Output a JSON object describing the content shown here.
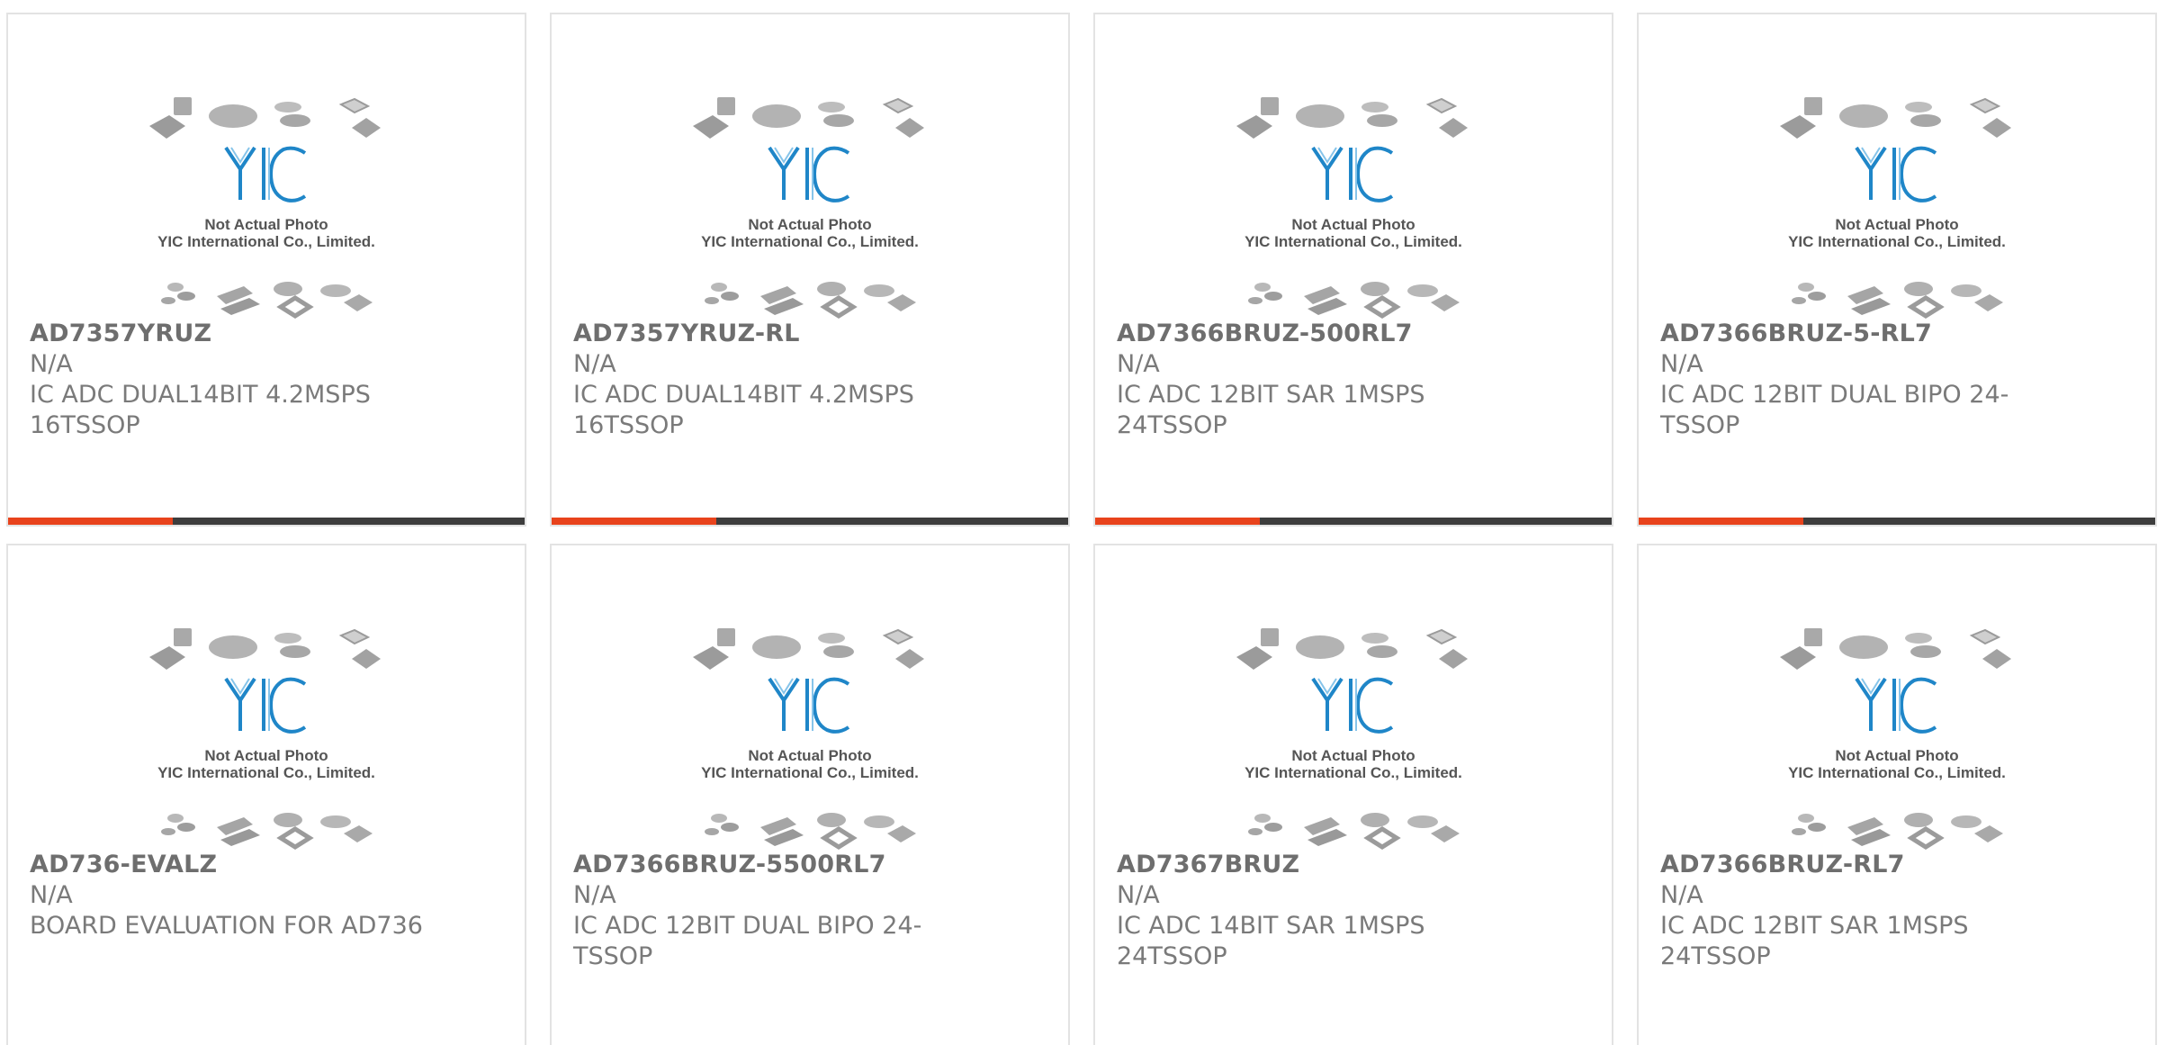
{
  "image_caption": {
    "line1": "Not Actual Photo",
    "line2": "YIC International Co., Limited.",
    "logo_text": "YIC"
  },
  "colors": {
    "accent": "#e8431c",
    "bar": "#3d3d3d",
    "logo_blue": "#1f86c8",
    "text": "#7a7a7a"
  },
  "products": [
    {
      "part": "AD7357YRUZ",
      "mfr": "N/A",
      "desc": "IC ADC DUAL14BIT 4.2MSPS 16TSSOP"
    },
    {
      "part": "AD7357YRUZ-RL",
      "mfr": "N/A",
      "desc": "IC ADC DUAL14BIT 4.2MSPS 16TSSOP"
    },
    {
      "part": "AD7366BRUZ-500RL7",
      "mfr": "N/A",
      "desc": "IC ADC 12BIT SAR 1MSPS 24TSSOP"
    },
    {
      "part": "AD7366BRUZ-5-RL7",
      "mfr": "N/A",
      "desc": "IC ADC 12BIT DUAL BIPO 24-TSSOP"
    },
    {
      "part": "AD736-EVALZ",
      "mfr": "N/A",
      "desc": "BOARD EVALUATION FOR AD736"
    },
    {
      "part": "AD7366BRUZ-5500RL7",
      "mfr": "N/A",
      "desc": "IC ADC 12BIT DUAL BIPO 24-TSSOP"
    },
    {
      "part": "AD7367BRUZ",
      "mfr": "N/A",
      "desc": "IC ADC 14BIT SAR 1MSPS 24TSSOP"
    },
    {
      "part": "AD7366BRUZ-RL7",
      "mfr": "N/A",
      "desc": "IC ADC 12BIT SAR 1MSPS 24TSSOP"
    }
  ]
}
